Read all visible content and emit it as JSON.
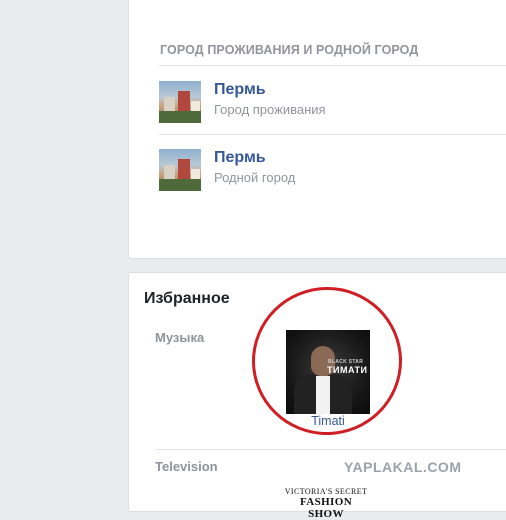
{
  "places": {
    "heading": "ГОРОД ПРОЖИВАНИЯ И РОДНОЙ ГОРОД",
    "items": [
      {
        "name": "Пермь",
        "subtitle": "Город проживания"
      },
      {
        "name": "Пермь",
        "subtitle": "Родной город"
      }
    ]
  },
  "favorites": {
    "title": "Избранное",
    "music": {
      "label": "Музыка",
      "item": {
        "caption": "Timati",
        "cover_band": "BLACK STAR",
        "cover_name": "ТИМАТИ"
      }
    },
    "television": {
      "label": "Television",
      "item": {
        "logo_line1": "VICTORIA'S SECRET",
        "logo_line2": "FASHION SHOW"
      }
    }
  },
  "annotation": {
    "color": "#cf1f25"
  },
  "watermark": {
    "text": "YAPLAKAL.COM"
  }
}
